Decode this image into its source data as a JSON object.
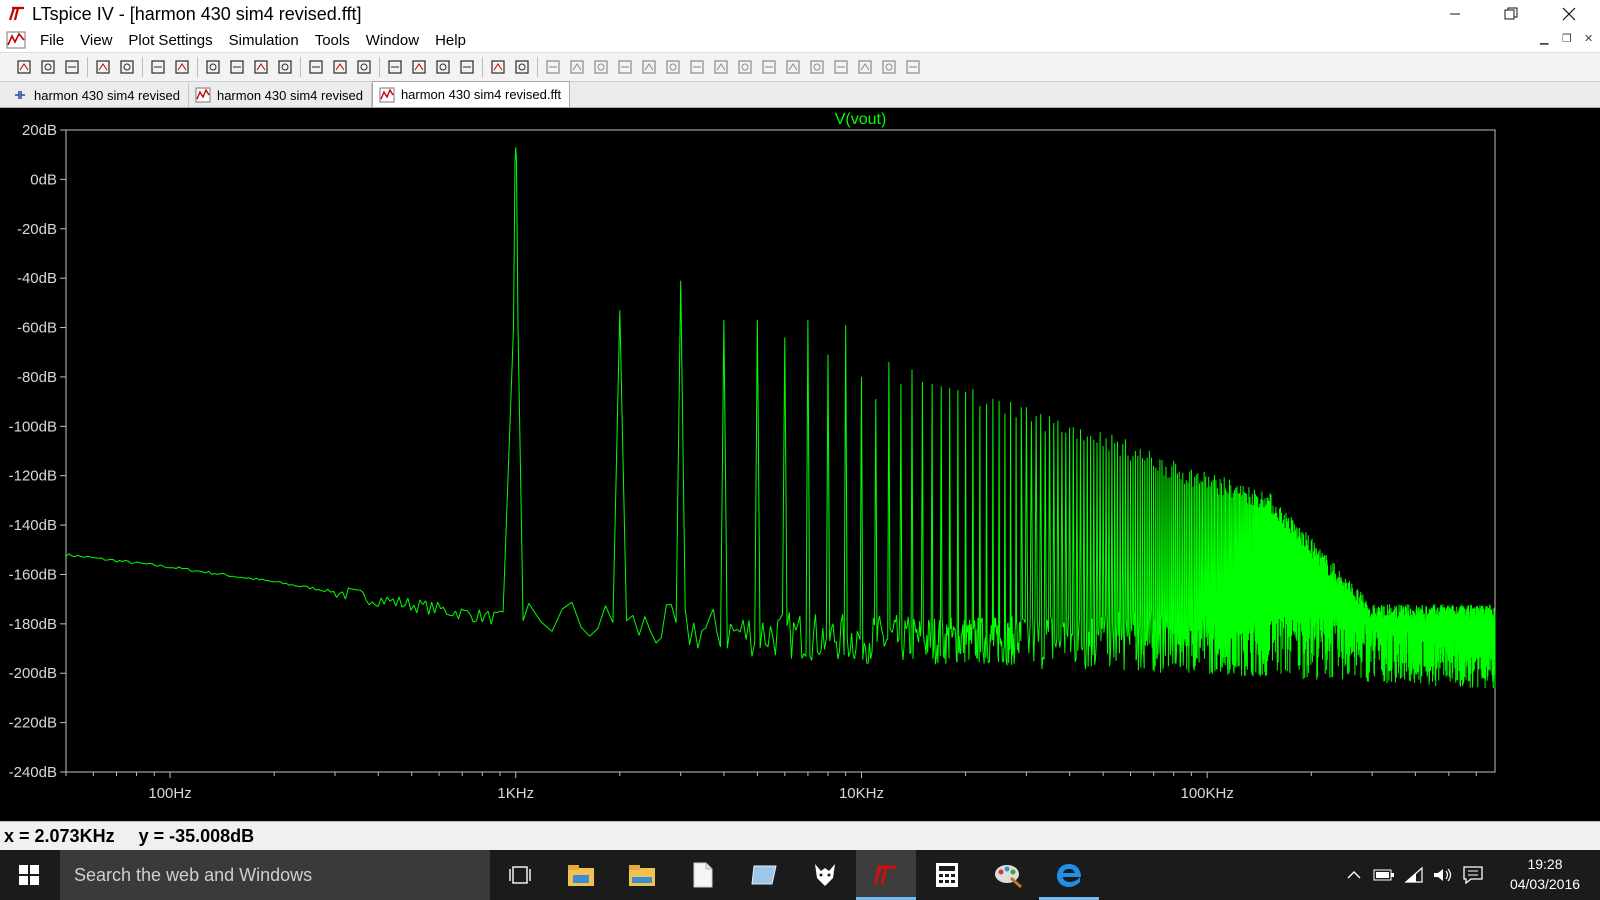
{
  "window": {
    "title": "LTspice IV - [harmon 430 sim4 revised.fft]",
    "logo_text": "LT",
    "minimize_icon": "minimize-icon",
    "restore_icon": "restore-icon",
    "close_icon": "close-icon"
  },
  "menu": {
    "items": [
      {
        "label": "File"
      },
      {
        "label": "View"
      },
      {
        "label": "Plot Settings"
      },
      {
        "label": "Simulation"
      },
      {
        "label": "Tools"
      },
      {
        "label": "Window"
      },
      {
        "label": "Help"
      }
    ]
  },
  "toolbar": {
    "icons": [
      "new-schematic-icon",
      "open-icon",
      "save-icon",
      "control-panel-icon",
      "run-icon",
      "halt-icon",
      "zoom-area-icon",
      "pan-icon",
      "zoom-back-icon",
      "zoom-fit-icon",
      "autorange-icon",
      "grid-icon",
      "split-plot-icon",
      "tile-windows-icon",
      "cascade-windows-icon",
      "cut-icon",
      "copy-icon",
      "paste-icon",
      "find-icon",
      "print-preview-icon",
      "print-icon",
      "wire-icon",
      "ground-icon",
      "label-icon",
      "resistor-icon",
      "capacitor-icon",
      "inductor-icon",
      "diode-icon",
      "component-icon",
      "move-icon",
      "drag-icon",
      "undo-icon",
      "redo-icon",
      "rotate-icon",
      "mirror-icon",
      "text-icon",
      "spice-directive-icon"
    ]
  },
  "tabs": [
    {
      "label": "harmon 430 sim4 revised",
      "icon": "schematic-icon"
    },
    {
      "label": "harmon 430 sim4 revised",
      "icon": "waveform-icon"
    },
    {
      "label": "harmon 430 sim4 revised.fft",
      "icon": "waveform-icon",
      "active": true
    }
  ],
  "plot": {
    "trace_label": "V(vout)",
    "trace_color": "#00ff00",
    "background": "#000000",
    "axis_color": "#bfbfbf"
  },
  "chart_data": {
    "type": "line",
    "title": "V(vout)",
    "xscale": "log",
    "xlabel": "",
    "ylabel": "",
    "xlim_hz": [
      50,
      680000
    ],
    "ylim_db": [
      -240,
      20
    ],
    "y_ticks": [
      "20dB",
      "0dB",
      "-20dB",
      "-40dB",
      "-60dB",
      "-80dB",
      "-100dB",
      "-120dB",
      "-140dB",
      "-160dB",
      "-180dB",
      "-200dB",
      "-220dB",
      "-240dB"
    ],
    "y_tick_values": [
      20,
      0,
      -20,
      -40,
      -60,
      -80,
      -100,
      -120,
      -140,
      -160,
      -180,
      -200,
      -220,
      -240
    ],
    "x_ticks": [
      "100Hz",
      "1KHz",
      "10KHz",
      "100KHz"
    ],
    "x_tick_values": [
      100,
      1000,
      10000,
      100000
    ],
    "fundamental": {
      "freq_hz": 1000,
      "db": 13
    },
    "harmonics": [
      {
        "n": 2,
        "db": -53
      },
      {
        "n": 3,
        "db": -41
      },
      {
        "n": 4,
        "db": -57
      },
      {
        "n": 5,
        "db": -57
      },
      {
        "n": 6,
        "db": -64
      },
      {
        "n": 7,
        "db": -57
      },
      {
        "n": 8,
        "db": -71
      },
      {
        "n": 9,
        "db": -59
      },
      {
        "n": 10,
        "db": -80
      },
      {
        "n": 11,
        "db": -89
      },
      {
        "n": 12,
        "db": -74
      },
      {
        "n": 13,
        "db": -83
      },
      {
        "n": 14,
        "db": -77
      },
      {
        "n": 15,
        "db": -82
      },
      {
        "n": 20,
        "db": -86
      },
      {
        "n": 30,
        "db": -96
      },
      {
        "n": 50,
        "db": -105
      },
      {
        "n": 80,
        "db": -118
      },
      {
        "n": 150,
        "db": -130
      },
      {
        "n": 300,
        "db": -176
      }
    ],
    "noise_floor": [
      {
        "freq_hz": 50,
        "db": -152
      },
      {
        "freq_hz": 100,
        "db": -157
      },
      {
        "freq_hz": 200,
        "db": -163
      },
      {
        "freq_hz": 400,
        "db": -170
      },
      {
        "freq_hz": 800,
        "db": -177
      },
      {
        "freq_hz": 2000,
        "db": -183
      },
      {
        "freq_hz": 10000,
        "db": -188
      },
      {
        "freq_hz": 100000,
        "db": -190
      },
      {
        "freq_hz": 680000,
        "db": -196
      }
    ]
  },
  "status": {
    "x_readout": "x = 2.073KHz",
    "y_readout": "y = -35.008dB"
  },
  "taskbar": {
    "search_placeholder": "Search the web and Windows",
    "apps": [
      "task-view-icon",
      "file-explorer-icon",
      "folder-icon",
      "document-icon",
      "sticky-icon",
      "foxit-icon",
      "ltspice-icon",
      "calculator-icon",
      "paint-icon",
      "edge-icon"
    ],
    "clock_time": "19:28",
    "clock_date": "04/03/2016"
  }
}
